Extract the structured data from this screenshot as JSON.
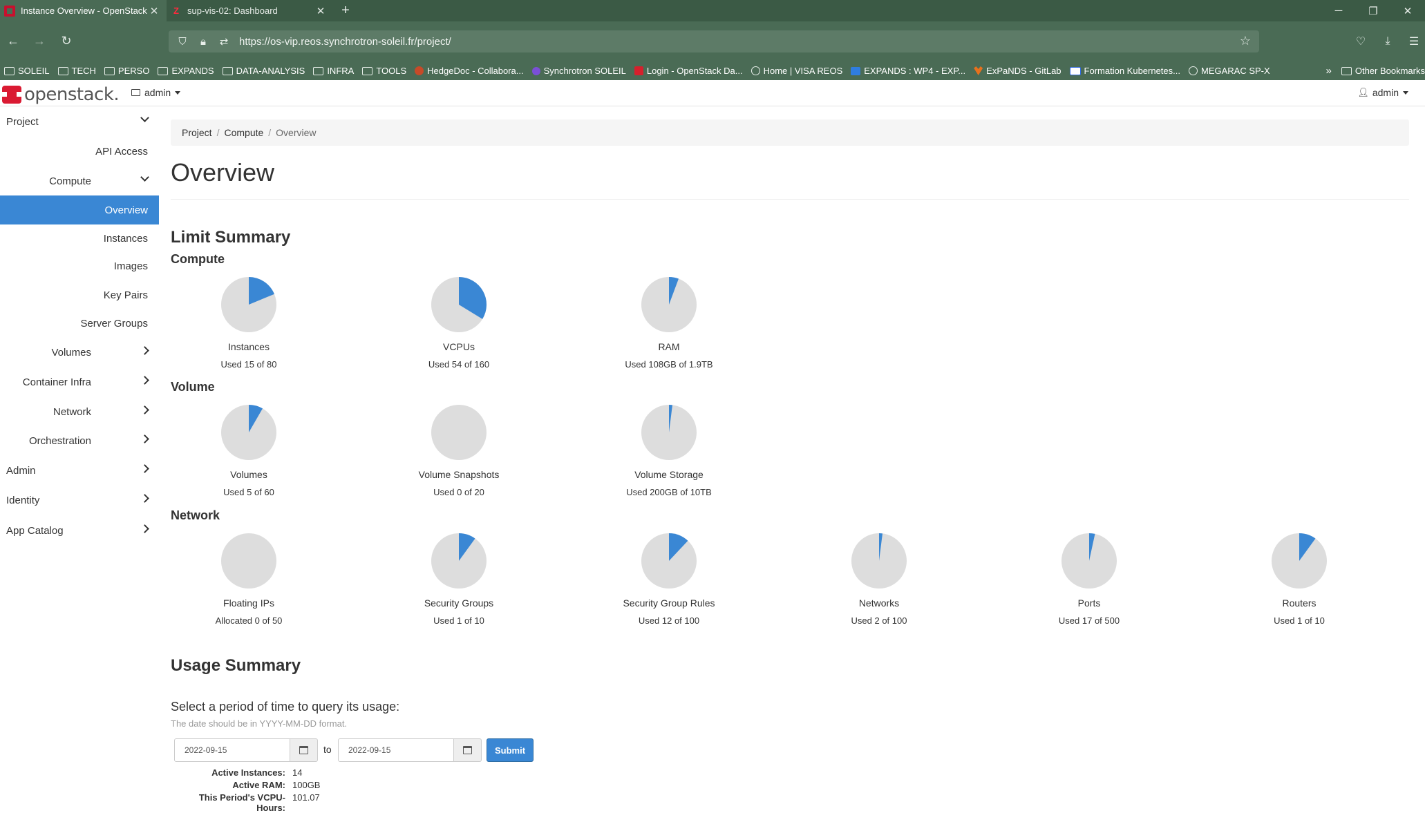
{
  "browser": {
    "tabs": [
      {
        "title": "Instance Overview - OpenStack",
        "active": true,
        "favicon": "openstack-favicon"
      },
      {
        "title": "sup-vis-02: Dashboard",
        "active": false,
        "favicon": "zabbix-favicon"
      }
    ],
    "favicon_z": "Z",
    "new_tab": "+",
    "url": "https://os-vip.reos.synchrotron-soleil.fr/project/",
    "bookmarks": [
      {
        "label": "SOLEIL",
        "icon": "folder"
      },
      {
        "label": "TECH",
        "icon": "folder"
      },
      {
        "label": "PERSO",
        "icon": "folder"
      },
      {
        "label": "EXPANDS",
        "icon": "folder"
      },
      {
        "label": "DATA-ANALYSIS",
        "icon": "folder"
      },
      {
        "label": "INFRA",
        "icon": "folder"
      },
      {
        "label": "TOOLS",
        "icon": "folder"
      },
      {
        "label": "HedgeDoc - Collabora...",
        "icon": "hedge"
      },
      {
        "label": "Synchrotron SOLEIL",
        "icon": "purple"
      },
      {
        "label": "Login - OpenStack Da...",
        "icon": "red"
      },
      {
        "label": "Home | VISA REOS",
        "icon": "globe"
      },
      {
        "label": "EXPANDS : WP4 - EXP...",
        "icon": "blue"
      },
      {
        "label": "ExPaNDS - GitLab",
        "icon": "orange"
      },
      {
        "label": "Formation Kubernetes...",
        "icon": "kube"
      },
      {
        "label": "MEGARAC SP-X",
        "icon": "globe"
      }
    ],
    "other_bookmarks": "Other Bookmarks"
  },
  "app": {
    "logo": "openstack.",
    "project_selector": "admin",
    "user_menu": "admin"
  },
  "sidebar": {
    "items": [
      {
        "label": "Project",
        "level": 0,
        "chevron": "down"
      },
      {
        "label": "API Access",
        "level": 1
      },
      {
        "label": "Compute",
        "level": 1,
        "chevron": "down"
      },
      {
        "label": "Overview",
        "level": 2,
        "active": true
      },
      {
        "label": "Instances",
        "level": 2
      },
      {
        "label": "Images",
        "level": 2
      },
      {
        "label": "Key Pairs",
        "level": 2
      },
      {
        "label": "Server Groups",
        "level": 2
      },
      {
        "label": "Volumes",
        "level": 1,
        "chevron": "right"
      },
      {
        "label": "Container Infra",
        "level": 1,
        "chevron": "right"
      },
      {
        "label": "Network",
        "level": 1,
        "chevron": "right"
      },
      {
        "label": "Orchestration",
        "level": 1,
        "chevron": "right"
      },
      {
        "label": "Admin",
        "level": 0,
        "chevron": "right"
      },
      {
        "label": "Identity",
        "level": 0,
        "chevron": "right"
      },
      {
        "label": "App Catalog",
        "level": 0,
        "chevron": "right"
      }
    ]
  },
  "breadcrumb": {
    "items": [
      "Project",
      "Compute"
    ],
    "current": "Overview"
  },
  "page_title": "Overview",
  "limit_summary": {
    "title": "Limit Summary",
    "groups": [
      {
        "title": "Compute",
        "charts": [
          {
            "name": "Instances",
            "used": 15,
            "total": 80,
            "caption": "Used 15 of 80"
          },
          {
            "name": "VCPUs",
            "used": 54,
            "total": 160,
            "caption": "Used 54 of 160"
          },
          {
            "name": "RAM",
            "used": 0.108,
            "total": 1.9,
            "caption": "Used 108GB of 1.9TB"
          }
        ]
      },
      {
        "title": "Volume",
        "charts": [
          {
            "name": "Volumes",
            "used": 5,
            "total": 60,
            "caption": "Used 5 of 60"
          },
          {
            "name": "Volume Snapshots",
            "used": 0,
            "total": 20,
            "caption": "Used 0 of 20"
          },
          {
            "name": "Volume Storage",
            "used": 0.2,
            "total": 10,
            "caption": "Used 200GB of 10TB"
          }
        ]
      },
      {
        "title": "Network",
        "charts": [
          {
            "name": "Floating IPs",
            "used": 0,
            "total": 50,
            "caption": "Allocated 0 of 50"
          },
          {
            "name": "Security Groups",
            "used": 1,
            "total": 10,
            "caption": "Used 1 of 10"
          },
          {
            "name": "Security Group Rules",
            "used": 12,
            "total": 100,
            "caption": "Used 12 of 100"
          },
          {
            "name": "Networks",
            "used": 2,
            "total": 100,
            "caption": "Used 2 of 100"
          },
          {
            "name": "Ports",
            "used": 17,
            "total": 500,
            "caption": "Used 17 of 500"
          },
          {
            "name": "Routers",
            "used": 1,
            "total": 10,
            "caption": "Used 1 of 10"
          }
        ]
      }
    ],
    "colors": {
      "used": "#3a87d4",
      "free": "#dddddd"
    }
  },
  "usage_summary": {
    "title": "Usage Summary",
    "query_title": "Select a period of time to query its usage:",
    "help": "The date should be in YYYY-MM-DD format.",
    "start_date": "2022-09-15",
    "to_label": "to",
    "end_date": "2022-09-15",
    "submit": "Submit",
    "stats": [
      {
        "label": "Active Instances:",
        "value": "14"
      },
      {
        "label": "Active RAM:",
        "value": "100GB"
      },
      {
        "label": "This Period's VCPU-Hours:",
        "value": "101.07"
      }
    ]
  }
}
